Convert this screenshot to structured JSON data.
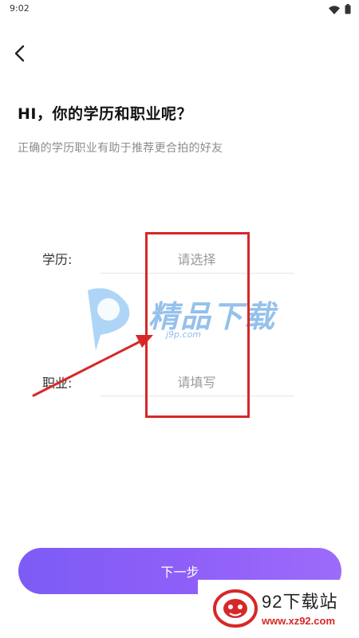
{
  "status_bar": {
    "time": "9:02",
    "icons": [
      "wifi-icon",
      "battery-icon"
    ]
  },
  "header": {
    "back_icon": "chevron-left-icon"
  },
  "content": {
    "title": "HI，你的学历和职业呢？",
    "subtitle": "正确的学历职业有助于推荐更合拍的好友"
  },
  "form": {
    "education": {
      "label": "学历:",
      "placeholder": "请选择"
    },
    "occupation": {
      "label": "职业:",
      "placeholder": "请填写"
    }
  },
  "next_button": {
    "label": "下一步"
  },
  "watermarks": {
    "jp_brand": "精品下载",
    "jp_url": "j9p.com",
    "site_name": "92下载站",
    "site_url": "www.xz92.com"
  },
  "colors": {
    "accent_start": "#7c5cf5",
    "accent_end": "#9d6bfb",
    "annotation": "#d62828",
    "placeholder": "#9a9a9a",
    "subtitle": "#8c8c8c"
  }
}
